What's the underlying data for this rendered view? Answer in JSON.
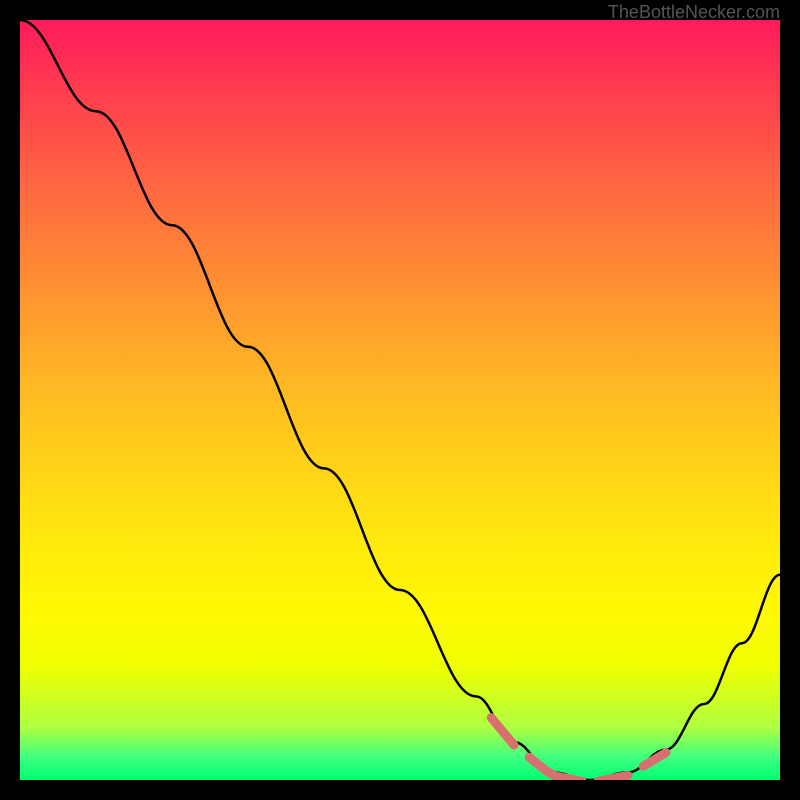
{
  "watermark": "TheBottleNecker.com",
  "chart_data": {
    "type": "line",
    "title": "",
    "xlabel": "",
    "ylabel": "",
    "x_range": [
      0,
      100
    ],
    "y_range": [
      0,
      100
    ],
    "background_gradient": {
      "description": "vertical gradient from red (top, high bottleneck) through orange and yellow to green (bottom, low bottleneck)",
      "stops": [
        "#ff1a5c",
        "#ff9a2f",
        "#ffe80e",
        "#00ff70"
      ]
    },
    "curve": {
      "description": "bottleneck percentage curve; descends steeply from upper-left, reaches minimum around x=70-80, then rises toward right",
      "points": [
        {
          "x": 0,
          "y": 100
        },
        {
          "x": 10,
          "y": 88
        },
        {
          "x": 20,
          "y": 73
        },
        {
          "x": 30,
          "y": 57
        },
        {
          "x": 40,
          "y": 41
        },
        {
          "x": 50,
          "y": 25
        },
        {
          "x": 60,
          "y": 11
        },
        {
          "x": 65,
          "y": 5
        },
        {
          "x": 70,
          "y": 1
        },
        {
          "x": 75,
          "y": 0
        },
        {
          "x": 80,
          "y": 1
        },
        {
          "x": 85,
          "y": 4
        },
        {
          "x": 90,
          "y": 10
        },
        {
          "x": 95,
          "y": 18
        },
        {
          "x": 100,
          "y": 27
        }
      ]
    },
    "markers": {
      "description": "salmon colored dashed marker segments near the curve minimum",
      "color": "#d87070",
      "segments": [
        {
          "x_start": 62,
          "x_end": 65
        },
        {
          "x_start": 67,
          "x_end": 74
        },
        {
          "x_start": 76,
          "x_end": 80
        },
        {
          "x_start": 82,
          "x_end": 85
        }
      ]
    }
  }
}
